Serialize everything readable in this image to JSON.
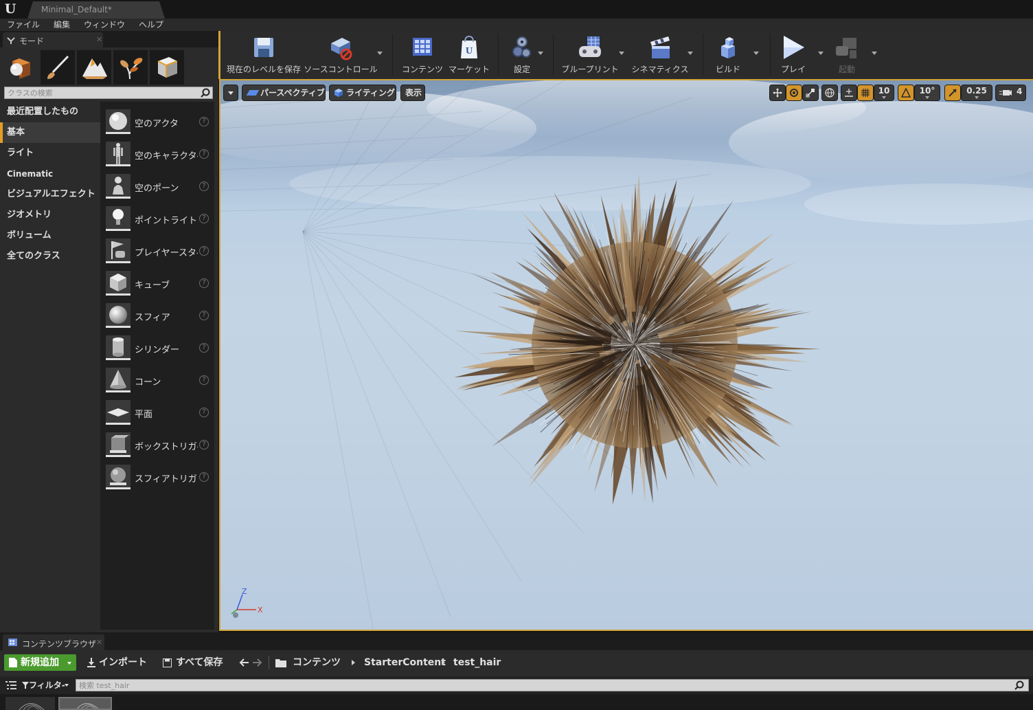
{
  "window": {
    "tab_title": "Minimal_Default*"
  },
  "menu": [
    "ファイル",
    "編集",
    "ウィンドウ",
    "ヘルプ"
  ],
  "modes_panel": {
    "tab_label": "モード",
    "mode_icons": [
      "place-mode-icon",
      "paint-mode-icon",
      "landscape-mode-icon",
      "foliage-mode-icon",
      "geometry-mode-icon"
    ],
    "search_placeholder": "クラスの検索",
    "categories": [
      "最近配置したもの",
      "基本",
      "ライト",
      "Cinematic",
      "ビジュアルエフェクト",
      "ジオメトリ",
      "ボリューム",
      "全てのクラス"
    ],
    "selected_category": "基本",
    "actors": [
      {
        "label": "空のアクタ",
        "icon": "empty-actor-icon"
      },
      {
        "label": "空のキャラクタ-",
        "icon": "empty-character-icon"
      },
      {
        "label": "空のポーン",
        "icon": "empty-pawn-icon"
      },
      {
        "label": "ポイントライト",
        "icon": "point-light-icon"
      },
      {
        "label": "プレイヤースタ-",
        "icon": "player-start-icon"
      },
      {
        "label": "キューブ",
        "icon": "cube-icon"
      },
      {
        "label": "スフィア",
        "icon": "sphere-icon"
      },
      {
        "label": "シリンダー",
        "icon": "cylinder-icon"
      },
      {
        "label": "コーン",
        "icon": "cone-icon"
      },
      {
        "label": "平面",
        "icon": "plane-icon"
      },
      {
        "label": "ボックストリガ-",
        "icon": "box-trigger-icon"
      },
      {
        "label": "スフィアトリガー",
        "icon": "sphere-trigger-icon"
      }
    ]
  },
  "toolbar": {
    "save_level": "現在のレベルを保存",
    "source_control": "ソースコントロール",
    "content": "コンテンツ",
    "marketplace": "マーケット",
    "settings": "設定",
    "blueprints": "ブループリント",
    "cinematics": "シネマティクス",
    "build": "ビルド",
    "play": "プレイ",
    "launch": "起動"
  },
  "viewport": {
    "perspective": "パースペクティブ",
    "lighting": "ライティング",
    "show": "表示",
    "grid_snap": "10",
    "rotation_snap": "10°",
    "scale_snap": "0.25",
    "camera_speed": "4",
    "axis_labels": {
      "z": "Z",
      "x": "X"
    },
    "colors": {
      "accent": "#d3a437",
      "sky_top": "#7e98b6",
      "sky_bottom": "#b9cbdf"
    }
  },
  "content_browser": {
    "tab_label": "コンテンツブラウザ",
    "add_new": "新規追加",
    "import": "インポート",
    "save_all": "すべて保存",
    "breadcrumbs": [
      "コンテンツ",
      "StarterContent",
      "test_hair"
    ],
    "filter": "フィルタ-",
    "search_placeholder": "検索 test_hair"
  }
}
